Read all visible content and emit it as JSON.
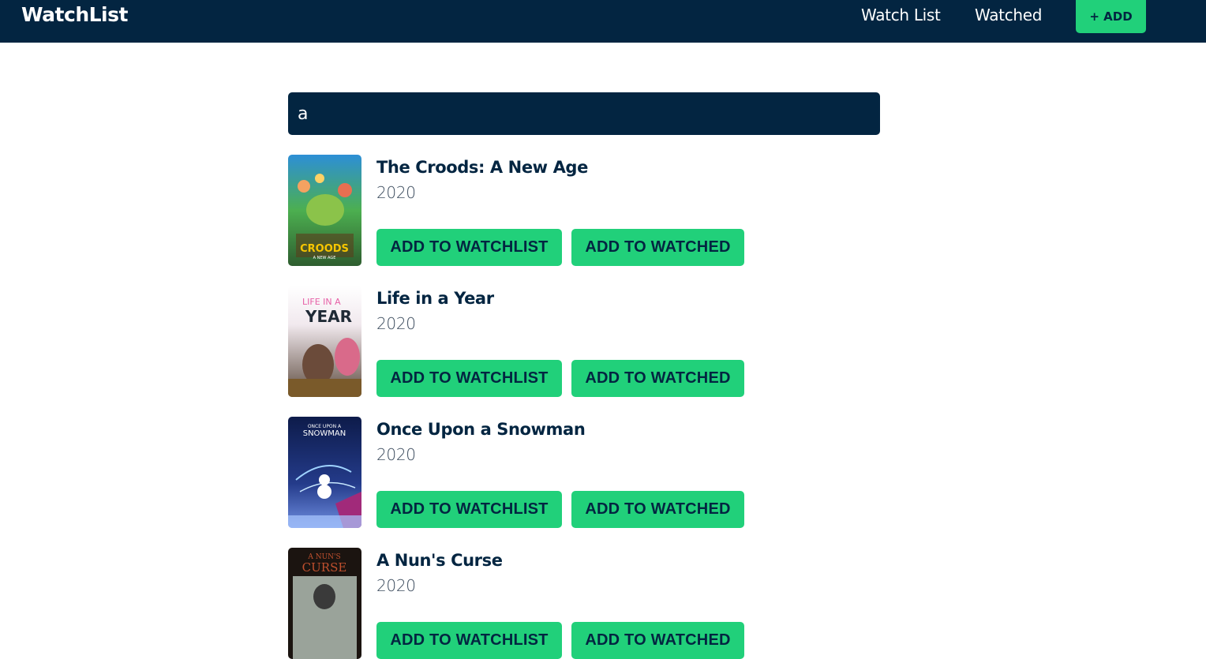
{
  "header": {
    "brand": "WatchList",
    "nav": {
      "watchlist": "Watch List",
      "watched": "Watched"
    },
    "add_label": "+ ADD"
  },
  "search": {
    "value": "a"
  },
  "results": [
    {
      "title": "The Croods: A New Age",
      "year": "2020",
      "poster_text": "CROODS",
      "poster_subtext": "A NEW AGE",
      "add_watchlist": "ADD TO WATCHLIST",
      "add_watched": "ADD TO WATCHED"
    },
    {
      "title": "Life in a Year",
      "year": "2020",
      "poster_text": "YEAR",
      "poster_subtext": "LIFE IN A",
      "add_watchlist": "ADD TO WATCHLIST",
      "add_watched": "ADD TO WATCHED"
    },
    {
      "title": "Once Upon a Snowman",
      "year": "2020",
      "poster_text": "SNOWMAN",
      "poster_subtext": "ONCE UPON A",
      "add_watchlist": "ADD TO WATCHLIST",
      "add_watched": "ADD TO WATCHED"
    },
    {
      "title": "A Nun's Curse",
      "year": "2020",
      "poster_text": "CURSE",
      "poster_subtext": "A NUN'S",
      "add_watchlist": "ADD TO WATCHLIST",
      "add_watched": "ADD TO WATCHED"
    }
  ],
  "colors": {
    "navy": "#032541",
    "green": "#21d07a",
    "white": "#ffffff"
  }
}
